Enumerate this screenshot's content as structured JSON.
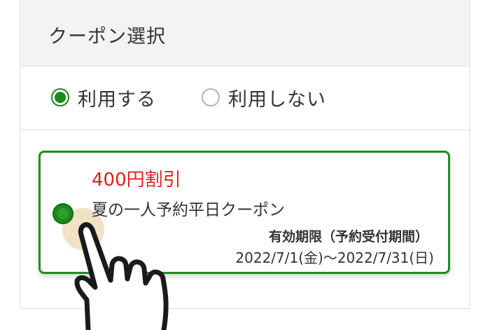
{
  "header": {
    "title": "クーポン選択"
  },
  "usage_options": {
    "use_label": "利用する",
    "no_use_label": "利用しない",
    "selected": "use"
  },
  "coupon": {
    "discount": "400円割引",
    "name": "夏の一人予約平日クーポン",
    "validity_label": "有効期限（予約受付期間）",
    "validity_dates": "2022/7/1(金)～2022/7/31(日)",
    "selected": true
  },
  "colors": {
    "accent_green": "#1f8f1f",
    "discount_red": "#e02020",
    "header_bg": "#f3f3f3"
  },
  "icons": [
    "radio-selected-icon",
    "radio-unselected-icon",
    "pointing-hand-icon"
  ]
}
